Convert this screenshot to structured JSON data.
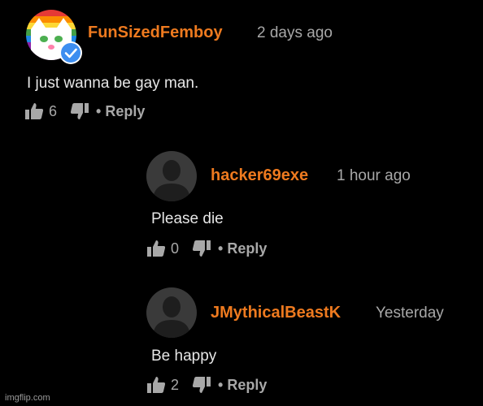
{
  "comments": [
    {
      "author": "FunSizedFemboy",
      "time": "2 days ago",
      "text": "I just wanna be gay man.",
      "likes": "6",
      "reply_label": "• Reply",
      "avatar_icon": "rainbow-cat-avatar",
      "verified_icon": "verified-check-icon"
    },
    {
      "author": "hacker69exe",
      "time": "1 hour ago",
      "text": "Please die",
      "likes": "0",
      "reply_label": "• Reply",
      "avatar_icon": "default-user-avatar"
    },
    {
      "author": "JMythicalBeastK",
      "time": "Yesterday",
      "text": "Be happy",
      "likes": "2",
      "reply_label": "• Reply",
      "avatar_icon": "default-user-avatar"
    }
  ],
  "watermark": "imgflip.com",
  "colors": {
    "author": "#ee7a1f",
    "meta": "#a8a8a8",
    "background": "#000000",
    "verified": "#3d8ef0"
  }
}
